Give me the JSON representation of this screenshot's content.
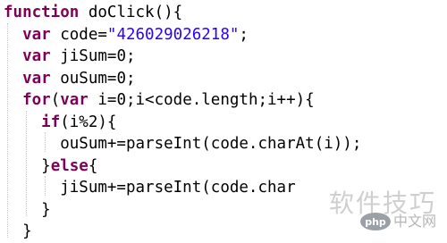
{
  "code_lines": [
    {
      "indent": "",
      "kw": "function",
      "rest": " doClick(){",
      "str": "",
      "tail": ""
    },
    {
      "indent": "  ",
      "kw": "var",
      "rest": " code=",
      "str": "\"426029026218\"",
      "tail": ";"
    },
    {
      "indent": "  ",
      "kw": "var",
      "rest": " jiSum=0;",
      "str": "",
      "tail": ""
    },
    {
      "indent": "  ",
      "kw": "var",
      "rest": " ouSum=0;",
      "str": "",
      "tail": ""
    },
    {
      "indent": "  ",
      "kw": "for",
      "rest": "(",
      "kw2": "var",
      "rest2": " i=0;i<code.length;i++){",
      "str": "",
      "tail": ""
    },
    {
      "indent": "    ",
      "kw": "if",
      "rest": "(i%2){",
      "str": "",
      "tail": ""
    },
    {
      "indent": "      ",
      "kw": "",
      "rest": "ouSum+=parseInt(code.charAt(i));",
      "str": "",
      "tail": ""
    },
    {
      "indent": "    ",
      "kw": "",
      "rest": "}",
      "kw2": "else",
      "rest2": "{",
      "str": "",
      "tail": ""
    },
    {
      "indent": "      ",
      "kw": "",
      "rest": "jiSum+=parseInt(code.char",
      "str": "",
      "tail": ""
    },
    {
      "indent": "    ",
      "kw": "",
      "rest": "}",
      "str": "",
      "tail": ""
    },
    {
      "indent": "  ",
      "kw": "",
      "rest": "}",
      "str": "",
      "tail": ""
    }
  ],
  "watermark": {
    "site_name": "软件技巧",
    "php_logo_text": "php",
    "php_site": "中文网"
  },
  "colors": {
    "keyword": "#7f0055",
    "string": "#2a00ff",
    "text": "#000000"
  }
}
